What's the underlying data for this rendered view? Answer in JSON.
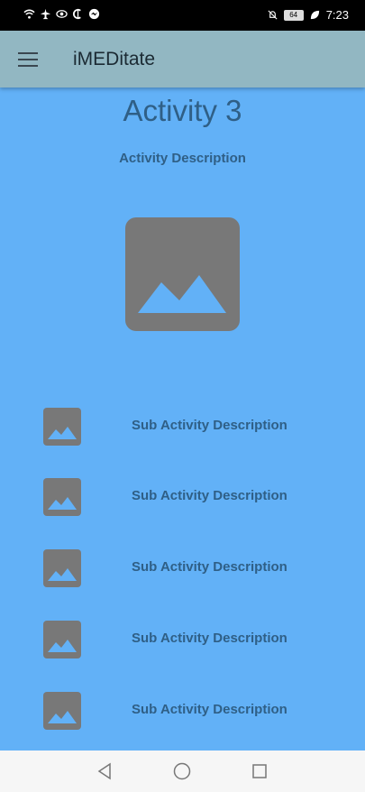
{
  "status_bar": {
    "left_icons": [
      "wifi-icon",
      "airplane-icon",
      "eye-icon",
      "currency-icon",
      "messenger-icon"
    ],
    "right_icons": [
      "mute-icon",
      "battery-icon",
      "leaf-icon"
    ],
    "battery_level": "64",
    "time": "7:23"
  },
  "app_bar": {
    "title": "iMEDitate",
    "menu_icon": "hamburger-icon"
  },
  "activity": {
    "title": "Activity 3",
    "description": "Activity Description",
    "image_icon": "image-placeholder-icon"
  },
  "sub_activities": [
    {
      "label": "Sub Activity Description"
    },
    {
      "label": "Sub Activity Description"
    },
    {
      "label": "Sub Activity Description"
    },
    {
      "label": "Sub Activity Description"
    },
    {
      "label": "Sub Activity Description"
    }
  ],
  "nav_bar": {
    "back_icon": "back-triangle-icon",
    "home_icon": "home-circle-icon",
    "recents_icon": "recents-square-icon"
  },
  "colors": {
    "background": "#62b1f7",
    "app_bar": "#92b7c2",
    "text": "#2f5f86",
    "placeholder": "#787878"
  }
}
